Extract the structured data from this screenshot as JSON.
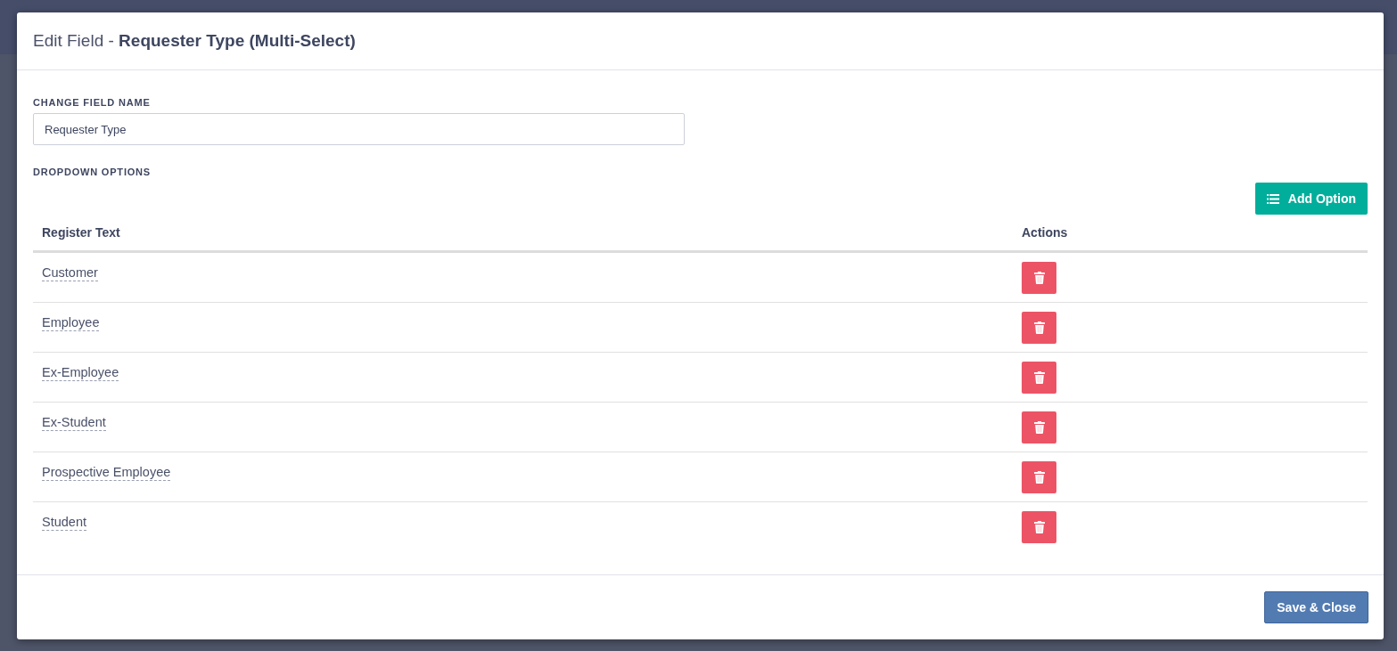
{
  "dialog": {
    "title_prefix": "Edit Field - ",
    "title_name": "Requester Type (Multi-Select)"
  },
  "field_name": {
    "label": "CHANGE FIELD NAME",
    "value": "Requester Type"
  },
  "options_label": "DROPDOWN OPTIONS",
  "add_button": "Add Option",
  "table": {
    "columns": [
      "Register Text",
      "Actions"
    ],
    "rows": [
      {
        "text": "Customer"
      },
      {
        "text": "Employee"
      },
      {
        "text": "Ex-Employee"
      },
      {
        "text": "Ex-Student"
      },
      {
        "text": "Prospective Employee"
      },
      {
        "text": "Student"
      }
    ]
  },
  "footer_button": "Save & Close"
}
